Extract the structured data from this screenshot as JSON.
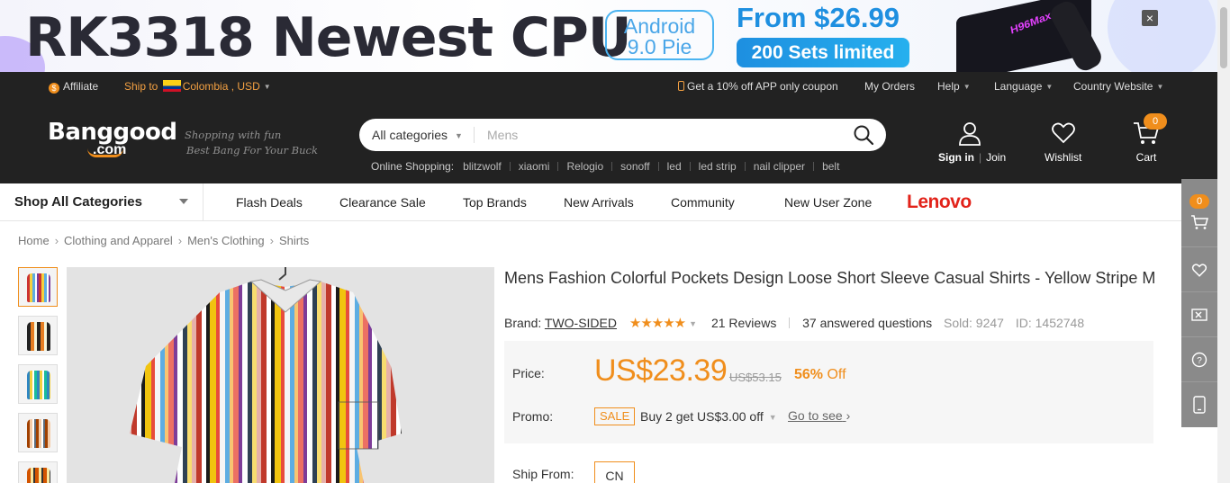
{
  "banner": {
    "headline": "RK3318 Newest CPU",
    "android_line1": "Android",
    "android_line2": "9.0 Pie",
    "price": "From $26.99",
    "limited": "200 Sets limited",
    "close": "×"
  },
  "topbar": {
    "affiliate": "Affiliate",
    "ship_to_label": "Ship to",
    "ship_to_value": "Colombia , USD",
    "app_coupon": "Get a 10% off APP only coupon",
    "my_orders": "My Orders",
    "help": "Help",
    "language": "Language",
    "country_website": "Country Website"
  },
  "header": {
    "logo_main": "Banggood",
    "logo_com": ".com",
    "slogan1": "Shopping with fun",
    "slogan2": "Best Bang For Your Buck",
    "search_category": "All categories",
    "search_placeholder": "Mens",
    "hot_label": "Online Shopping:",
    "hot_keywords": [
      "blitzwolf",
      "xiaomi",
      "Relogio",
      "sonoff",
      "led",
      "led strip",
      "nail clipper",
      "belt"
    ],
    "sign_in": "Sign in",
    "join": "Join",
    "wishlist": "Wishlist",
    "cart": "Cart",
    "cart_count": "0"
  },
  "nav": {
    "shop_all": "Shop All Categories",
    "items": [
      "Flash Deals",
      "Clearance Sale",
      "Top Brands",
      "New Arrivals",
      "Community",
      "New User Zone"
    ],
    "lenovo": "Lenovo"
  },
  "sidebar": {
    "cart_count": "0"
  },
  "breadcrumb": [
    "Home",
    "Clothing and Apparel",
    "Men's Clothing",
    "Shirts"
  ],
  "product": {
    "title": "Mens Fashion Colorful Pockets Design Loose Short Sleeve Casual Shirts - Yellow Stripe M",
    "brand_label": "Brand:",
    "brand": "TWO-SIDED",
    "rating": 5,
    "reviews": "21 Reviews",
    "questions": "37 answered questions",
    "sold": "Sold: 9247",
    "id": "ID: 1452748",
    "price_label": "Price:",
    "price": "US$23.39",
    "old_price": "US$53.15",
    "discount_pct": "56%",
    "discount_word": "Off",
    "promo_label": "Promo:",
    "promo_badge": "SALE",
    "promo_text": "Buy 2 get US$3.00 off",
    "promo_link": "Go to see",
    "ship_from_label": "Ship From:",
    "ship_from_value": "CN"
  },
  "colors": {
    "accent": "#f08e1c",
    "dark": "#222222",
    "lenovo": "#e2231a"
  }
}
